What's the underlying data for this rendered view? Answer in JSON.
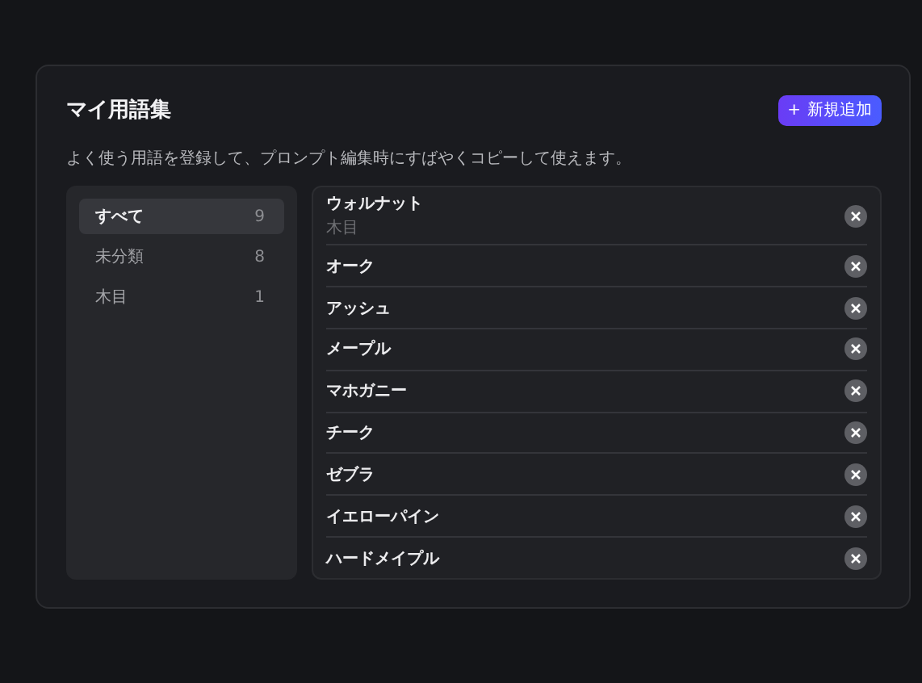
{
  "title": "マイ用語集",
  "add_button": {
    "icon": "+",
    "label": "新規追加"
  },
  "description": "よく使う用語を登録して、プロンプト編集時にすばやくコピーして使えます。",
  "categories": [
    {
      "label": "すべて",
      "count": "9",
      "selected": true
    },
    {
      "label": "未分類",
      "count": "8",
      "selected": false
    },
    {
      "label": "木目",
      "count": "1",
      "selected": false
    }
  ],
  "terms": [
    {
      "name": "ウォルナット",
      "category": "木目"
    },
    {
      "name": "オーク"
    },
    {
      "name": "アッシュ"
    },
    {
      "name": "メープル"
    },
    {
      "name": "マホガニー"
    },
    {
      "name": "チーク"
    },
    {
      "name": "ゼブラ"
    },
    {
      "name": "イエローパイン"
    },
    {
      "name": "ハードメイプル"
    }
  ]
}
